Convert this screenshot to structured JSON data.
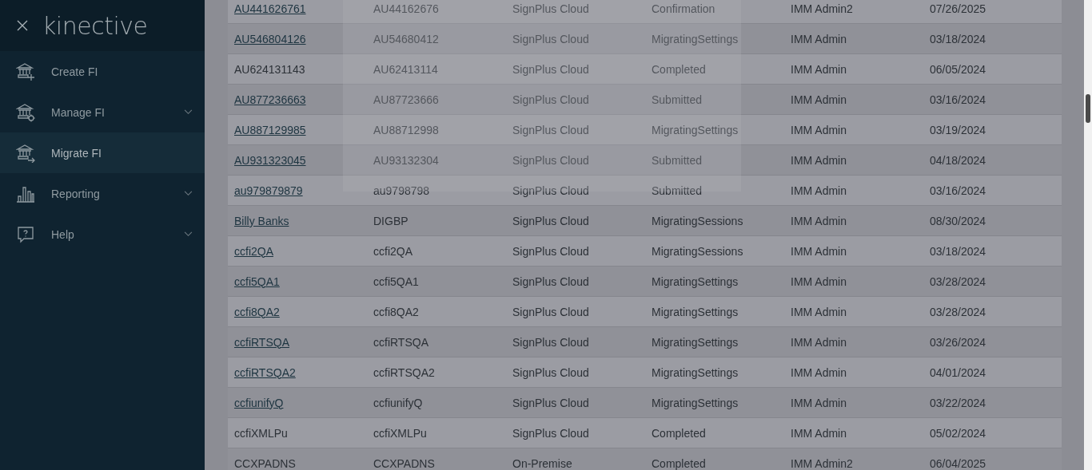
{
  "sidebar": {
    "logo": "kinective",
    "items": [
      {
        "label": "Create FI",
        "kind": "bank-plus",
        "selected": false,
        "expandable": false
      },
      {
        "label": "Manage FI",
        "kind": "bank-gear",
        "selected": false,
        "expandable": true
      },
      {
        "label": "Migrate FI",
        "kind": "bank-arrow",
        "selected": true,
        "expandable": false
      },
      {
        "label": "Reporting",
        "kind": "chart",
        "selected": false,
        "expandable": true
      },
      {
        "label": "Help",
        "kind": "help",
        "selected": false,
        "expandable": true
      }
    ]
  },
  "table": {
    "rows": [
      {
        "link": true,
        "cells": [
          "AU441626761",
          "AU44162676",
          "SignPlus Cloud",
          "Confirmation",
          "IMM Admin2",
          "07/26/2025"
        ]
      },
      {
        "link": true,
        "cells": [
          "AU546804126",
          "AU54680412",
          "SignPlus Cloud",
          "MigratingSettings",
          "IMM Admin",
          "03/18/2024"
        ]
      },
      {
        "link": false,
        "cells": [
          "AU624131143",
          "AU62413114",
          "SignPlus Cloud",
          "Completed",
          "IMM Admin",
          "06/05/2024"
        ]
      },
      {
        "link": true,
        "cells": [
          "AU877236663",
          "AU87723666",
          "SignPlus Cloud",
          "Submitted",
          "IMM Admin",
          "03/16/2024"
        ]
      },
      {
        "link": true,
        "cells": [
          "AU887129985",
          "AU88712998",
          "SignPlus Cloud",
          "MigratingSettings",
          "IMM Admin",
          "03/19/2024"
        ]
      },
      {
        "link": true,
        "cells": [
          "AU931323045",
          "AU93132304",
          "SignPlus Cloud",
          "Submitted",
          "IMM Admin",
          "04/18/2024"
        ]
      },
      {
        "link": true,
        "cells": [
          "au979879879",
          "au9798798",
          "SignPlus Cloud",
          "Submitted",
          "IMM Admin",
          "03/16/2024"
        ]
      },
      {
        "link": true,
        "cells": [
          "Billy Banks",
          "DIGBP",
          "SignPlus Cloud",
          "MigratingSessions",
          "IMM Admin",
          "08/30/2024"
        ]
      },
      {
        "link": true,
        "cells": [
          "ccfi2QA",
          "ccfi2QA",
          "SignPlus Cloud",
          "MigratingSessions",
          "IMM Admin",
          "03/18/2024"
        ]
      },
      {
        "link": true,
        "cells": [
          "ccfi5QA1",
          "ccfi5QA1",
          "SignPlus Cloud",
          "MigratingSettings",
          "IMM Admin",
          "03/28/2024"
        ]
      },
      {
        "link": true,
        "cells": [
          "ccfi8QA2",
          "ccfi8QA2",
          "SignPlus Cloud",
          "MigratingSettings",
          "IMM Admin",
          "03/28/2024"
        ]
      },
      {
        "link": true,
        "cells": [
          "ccfiRTSQA",
          "ccfiRTSQA",
          "SignPlus Cloud",
          "MigratingSettings",
          "IMM Admin",
          "03/26/2024"
        ]
      },
      {
        "link": true,
        "cells": [
          "ccfiRTSQA2",
          "ccfiRTSQA2",
          "SignPlus Cloud",
          "MigratingSettings",
          "IMM Admin",
          "04/01/2024"
        ]
      },
      {
        "link": true,
        "cells": [
          "ccfiunifyQ",
          "ccfiunifyQ",
          "SignPlus Cloud",
          "MigratingSettings",
          "IMM Admin",
          "03/22/2024"
        ]
      },
      {
        "link": false,
        "cells": [
          "ccfiXMLPu",
          "ccfiXMLPu",
          "SignPlus Cloud",
          "Completed",
          "IMM Admin",
          "05/02/2024"
        ]
      },
      {
        "link": false,
        "cells": [
          "CCXPADNS",
          "CCXPADNS",
          "On-Premise",
          "Completed",
          "IMM Admin2",
          "06/04/2025"
        ]
      }
    ]
  },
  "dialog": {
    "kind": "faded-panel"
  }
}
